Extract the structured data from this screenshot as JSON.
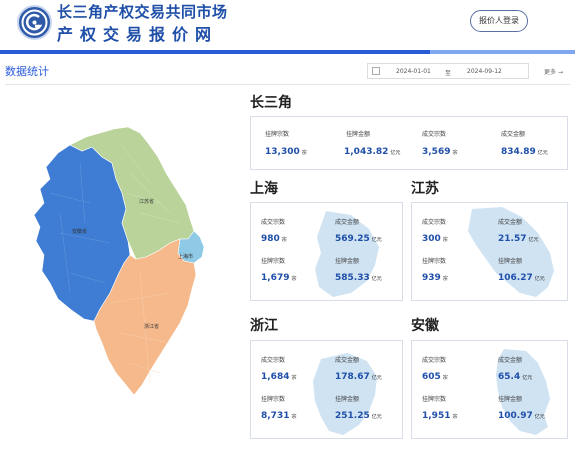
{
  "header": {
    "title_line1": "长三角产权交易共同市场",
    "title_line2": "产权交易报价网",
    "login_label": "报价人登录",
    "brand_color": "#1f4fa8",
    "accent_color": "#2a5bd7"
  },
  "section": {
    "title": "数据统计",
    "date_start": "2024-01-01",
    "date_separator": "至",
    "date_end": "2024-09-12",
    "more_label": "更多",
    "calendar_icon": "calendar-icon",
    "arrow_icon": "arrow-right-icon"
  },
  "map": {
    "labels": {
      "jiangsu": "江苏省",
      "anhui": "安徽省",
      "shanghai": "上海市",
      "zhejiang": "浙江省"
    },
    "colors": {
      "jiangsu": "#b9d39a",
      "anhui": "#3e7dd3",
      "shanghai": "#8ec9e6",
      "zhejiang": "#f5b98c"
    }
  },
  "regions": {
    "csj": {
      "title": "长三角",
      "stats": [
        {
          "label": "挂牌宗数",
          "value": "13,300",
          "unit": "宗"
        },
        {
          "label": "挂牌金额",
          "value": "1,043.82",
          "unit": "亿元"
        },
        {
          "label": "成交宗数",
          "value": "3,569",
          "unit": "宗"
        },
        {
          "label": "成交金额",
          "value": "834.89",
          "unit": "亿元"
        }
      ]
    },
    "shanghai": {
      "title": "上海",
      "stats": [
        {
          "label": "成交宗数",
          "value": "980",
          "unit": "宗"
        },
        {
          "label": "成交金额",
          "value": "569.25",
          "unit": "亿元"
        },
        {
          "label": "挂牌宗数",
          "value": "1,679",
          "unit": "宗"
        },
        {
          "label": "挂牌金额",
          "value": "585.33",
          "unit": "亿元"
        }
      ]
    },
    "jiangsu": {
      "title": "江苏",
      "stats": [
        {
          "label": "成交宗数",
          "value": "300",
          "unit": "宗"
        },
        {
          "label": "成交金额",
          "value": "21.57",
          "unit": "亿元"
        },
        {
          "label": "挂牌宗数",
          "value": "939",
          "unit": "宗"
        },
        {
          "label": "挂牌金额",
          "value": "106.27",
          "unit": "亿元"
        }
      ]
    },
    "zhejiang": {
      "title": "浙江",
      "stats": [
        {
          "label": "成交宗数",
          "value": "1,684",
          "unit": "宗"
        },
        {
          "label": "成交金额",
          "value": "178.67",
          "unit": "亿元"
        },
        {
          "label": "挂牌宗数",
          "value": "8,731",
          "unit": "宗"
        },
        {
          "label": "挂牌金额",
          "value": "251.25",
          "unit": "亿元"
        }
      ]
    },
    "anhui": {
      "title": "安徽",
      "stats": [
        {
          "label": "成交宗数",
          "value": "605",
          "unit": "宗"
        },
        {
          "label": "成交金额",
          "value": "65.4",
          "unit": "亿元"
        },
        {
          "label": "挂牌宗数",
          "value": "1,951",
          "unit": "宗"
        },
        {
          "label": "挂牌金额",
          "value": "100.97",
          "unit": "亿元"
        }
      ]
    }
  }
}
